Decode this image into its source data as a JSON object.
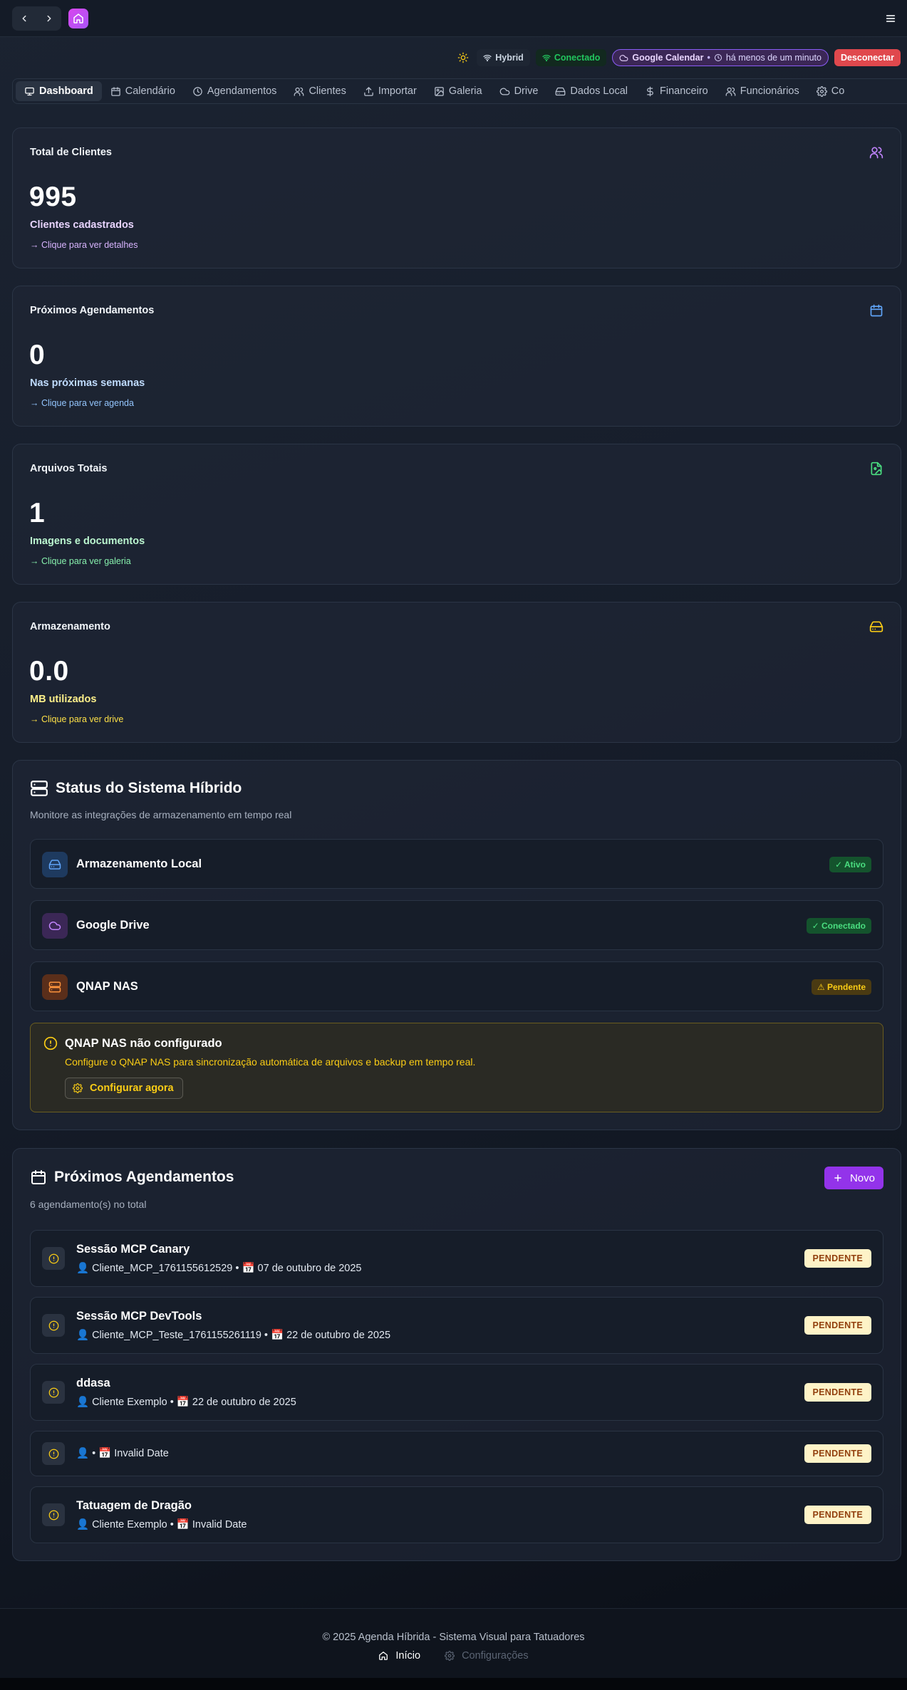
{
  "topbar": {
    "back_icon": "chevron-left-icon",
    "forward_icon": "chevron-right-icon",
    "home_icon": "home-icon",
    "menu_icon": "menu-icon"
  },
  "status": {
    "mode": "Hybrid",
    "connection": "Conectado",
    "gcal_label": "Google Calendar",
    "gcal_sync": "há menos de um minuto",
    "disconnect": "Desconectar"
  },
  "tabs": [
    {
      "label": "Dashboard",
      "icon": "monitor-icon",
      "active": true
    },
    {
      "label": "Calendário",
      "icon": "calendar-icon"
    },
    {
      "label": "Agendamentos",
      "icon": "clock-icon"
    },
    {
      "label": "Clientes",
      "icon": "users-icon"
    },
    {
      "label": "Importar",
      "icon": "upload-icon"
    },
    {
      "label": "Galeria",
      "icon": "image-icon"
    },
    {
      "label": "Drive",
      "icon": "cloud-icon"
    },
    {
      "label": "Dados Local",
      "icon": "hard-drive-icon"
    },
    {
      "label": "Financeiro",
      "icon": "dollar-icon"
    },
    {
      "label": "Funcionários",
      "icon": "users-icon"
    },
    {
      "label": "Co",
      "icon": "gear-icon"
    }
  ],
  "stats": [
    {
      "title": "Total de Clientes",
      "value": "995",
      "desc": "Clientes cadastrados",
      "link": "→ Clique para ver detalhes",
      "color": "#c084fc",
      "icon": "users-icon"
    },
    {
      "title": "Próximos Agendamentos",
      "value": "0",
      "desc": "Nas próximas semanas",
      "link": "→ Clique para ver agenda",
      "color": "#93c5fd",
      "icon": "calendar-icon"
    },
    {
      "title": "Arquivos Totais",
      "value": "1",
      "desc": "Imagens e documentos",
      "link": "→ Clique para ver galeria",
      "color": "#86efac",
      "icon": "file-image-icon"
    },
    {
      "title": "Armazenamento",
      "value": "0.0",
      "desc": "MB utilizados",
      "link": "→ Clique para ver drive",
      "color": "#fde047",
      "icon": "hard-drive-icon"
    }
  ],
  "hybrid": {
    "title": "Status do Sistema Híbrido",
    "subtitle": "Monitore as integrações de armazenamento em tempo real",
    "integrations": [
      {
        "name": "Armazenamento Local",
        "badge": "✓ Ativo",
        "icon": "hard-drive-icon"
      },
      {
        "name": "Google Drive",
        "badge": "✓ Conectado",
        "icon": "cloud-icon"
      },
      {
        "name": "QNAP NAS",
        "badge": "⚠ Pendente",
        "icon": "server-icon"
      }
    ],
    "warning": {
      "title": "QNAP NAS não configurado",
      "desc": "Configure o QNAP NAS para sincronização automática de arquivos e backup em tempo real.",
      "button": "Configurar agora"
    }
  },
  "appointments": {
    "title": "Próximos Agendamentos",
    "count": "6 agendamento(s) no total",
    "new_button": "Novo",
    "items": [
      {
        "title": "Sessão MCP Canary",
        "meta": "👤 Cliente_MCP_1761155612529 • 📅 07 de outubro de 2025",
        "status": "PENDENTE"
      },
      {
        "title": "Sessão MCP DevTools",
        "meta": "👤 Cliente_MCP_Teste_1761155261119 • 📅 22 de outubro de 2025",
        "status": "PENDENTE"
      },
      {
        "title": "ddasa",
        "meta": "👤 Cliente Exemplo • 📅 22 de outubro de 2025",
        "status": "PENDENTE"
      },
      {
        "title": "",
        "meta": "👤 • 📅 Invalid Date",
        "status": "PENDENTE"
      },
      {
        "title": "Tatuagem de Dragão",
        "meta": "👤 Cliente Exemplo • 📅 Invalid Date",
        "status": "PENDENTE"
      }
    ]
  },
  "footer": {
    "copyright": "© 2025 Agenda Híbrida - Sistema Visual para Tatuadores",
    "home": "Início",
    "settings": "Configurações"
  }
}
